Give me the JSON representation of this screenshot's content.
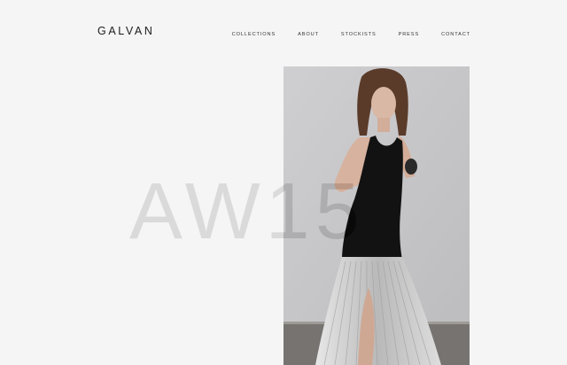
{
  "brand": {
    "logo_text": "GALVAN"
  },
  "nav": {
    "items": [
      {
        "label": "COLLECTIONS"
      },
      {
        "label": "ABOUT"
      },
      {
        "label": "STOCKISTS"
      },
      {
        "label": "PRESS"
      },
      {
        "label": "CONTACT"
      }
    ]
  },
  "hero": {
    "season_text": "AW15",
    "photo_alt": "Model in black top and silver fringe skirt"
  },
  "colors": {
    "background": "#f5f5f5",
    "text": "#1a1a1a"
  }
}
